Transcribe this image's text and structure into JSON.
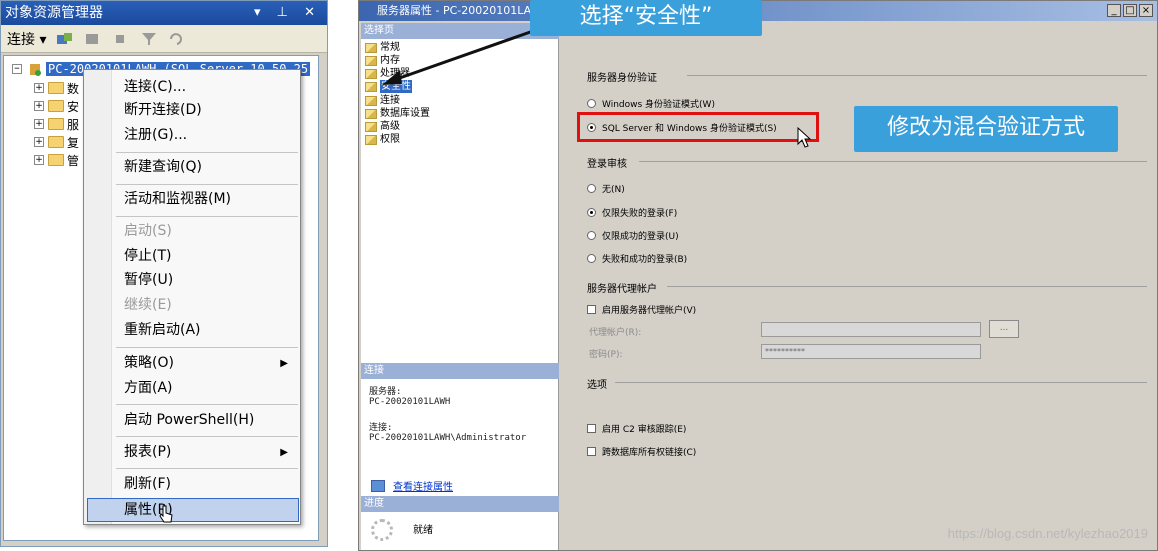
{
  "object_explorer": {
    "title": "对象资源管理器",
    "title_controls": "▾ ⊥ ✕",
    "toolbar": {
      "connect_label": "连接 ▾"
    },
    "server_node": "PC-20020101LAWH (SQL Server 10.50.25",
    "children": [
      "数",
      "安",
      "服",
      "复",
      "管"
    ],
    "context_menu": [
      {
        "label": "连接(C)...",
        "disabled": false
      },
      {
        "label": "断开连接(D)",
        "disabled": false
      },
      {
        "label": "注册(G)...",
        "disabled": false
      },
      {
        "label": "新建查询(Q)",
        "disabled": false
      },
      {
        "label": "活动和监视器(M)",
        "disabled": false
      },
      {
        "label": "启动(S)",
        "disabled": true
      },
      {
        "label": "停止(T)",
        "disabled": false
      },
      {
        "label": "暂停(U)",
        "disabled": false
      },
      {
        "label": "继续(E)",
        "disabled": true
      },
      {
        "label": "重新启动(A)",
        "disabled": false
      },
      {
        "label": "策略(O)",
        "disabled": false,
        "submenu": true
      },
      {
        "label": "方面(A)",
        "disabled": false
      },
      {
        "label": "启动 PowerShell(H)",
        "disabled": false
      },
      {
        "label": "报表(P)",
        "disabled": false,
        "submenu": true
      },
      {
        "label": "刷新(F)",
        "disabled": false
      },
      {
        "label": "属性(R)",
        "disabled": false,
        "highlighted": true
      }
    ]
  },
  "server_properties": {
    "title": "服务器属性 - PC-20020101LA",
    "window_controls": [
      "_",
      "□",
      "×"
    ],
    "select_page_header": "选择页",
    "pages": [
      "常规",
      "内存",
      "处理器",
      "安全性",
      "连接",
      "数据库设置",
      "高级",
      "权限"
    ],
    "selected_page": "安全性",
    "connection_header": "连接",
    "server_label": "服务器:",
    "server_value": "PC-20020101LAWH",
    "connection_label": "连接:",
    "connection_value": "PC-20020101LAWH\\Administrator",
    "view_connection_link": "查看连接属性",
    "progress_header": "进度",
    "progress_status": "就绪",
    "auth_group": "服务器身份验证",
    "auth_windows": "Windows 身份验证模式(W)",
    "auth_mixed": "SQL Server 和 Windows 身份验证模式(S)",
    "login_audit_group": "登录审核",
    "audit_none": "无(N)",
    "audit_failed": "仅限失败的登录(F)",
    "audit_success": "仅限成功的登录(U)",
    "audit_both": "失败和成功的登录(B)",
    "proxy_group": "服务器代理帐户",
    "proxy_enable": "启用服务器代理帐户(V)",
    "proxy_account_label": "代理帐户(R):",
    "password_label": "密码(P):",
    "password_value": "**********",
    "browse_label": "...",
    "options_group": "选项",
    "c2_audit": "启用 C2 审核跟踪(E)",
    "cross_db": "跨数据库所有权链接(C)"
  },
  "callouts": {
    "select_security": "选择“安全性”",
    "mixed_auth": "修改为混合验证方式"
  },
  "watermark": "https://blog.csdn.net/kylezhao2019",
  "colors": {
    "callout_bg": "#3aa0dc",
    "highlight_box": "#e01010",
    "selection": "#316ac5"
  }
}
